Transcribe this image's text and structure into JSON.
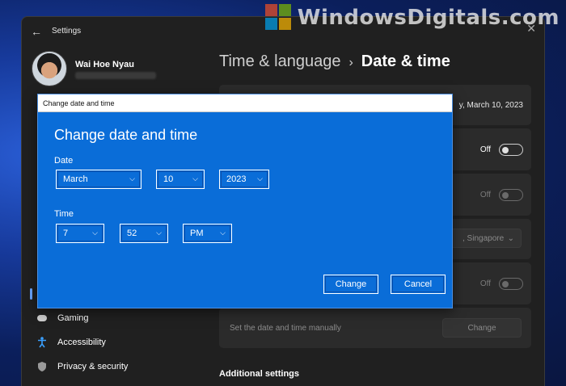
{
  "watermark": {
    "text": "WindowsDigitals.com"
  },
  "window": {
    "title": "Settings",
    "back_icon": "back-arrow-icon"
  },
  "user": {
    "name": "Wai Hoe Nyau"
  },
  "breadcrumb": {
    "parent": "Time & language",
    "separator": "›",
    "current": "Date & time"
  },
  "cards": {
    "date_partial": "y, March 10, 2023",
    "toggle1_state": "Off",
    "toggle2_state": "Off",
    "timezone_partial": ", Singapore",
    "toggle3_state": "Off",
    "manual_label": "Set the date and time manually",
    "change_button": "Change"
  },
  "nav": {
    "items": [
      {
        "label": "Gaming",
        "icon": "gamepad-icon"
      },
      {
        "label": "Accessibility",
        "icon": "accessibility-icon"
      },
      {
        "label": "Privacy & security",
        "icon": "shield-icon"
      }
    ]
  },
  "additional_heading": "Additional settings",
  "dialog": {
    "title": "Change date and time",
    "heading": "Change date and time",
    "date_label": "Date",
    "month": "March",
    "day": "10",
    "year": "2023",
    "time_label": "Time",
    "hour": "7",
    "minute": "52",
    "ampm": "PM",
    "change_button": "Change",
    "cancel_button": "Cancel"
  },
  "colors": {
    "dialog_blue": "#0a6dd8",
    "window_bg": "#202020",
    "card_bg": "#2b2b2b"
  }
}
